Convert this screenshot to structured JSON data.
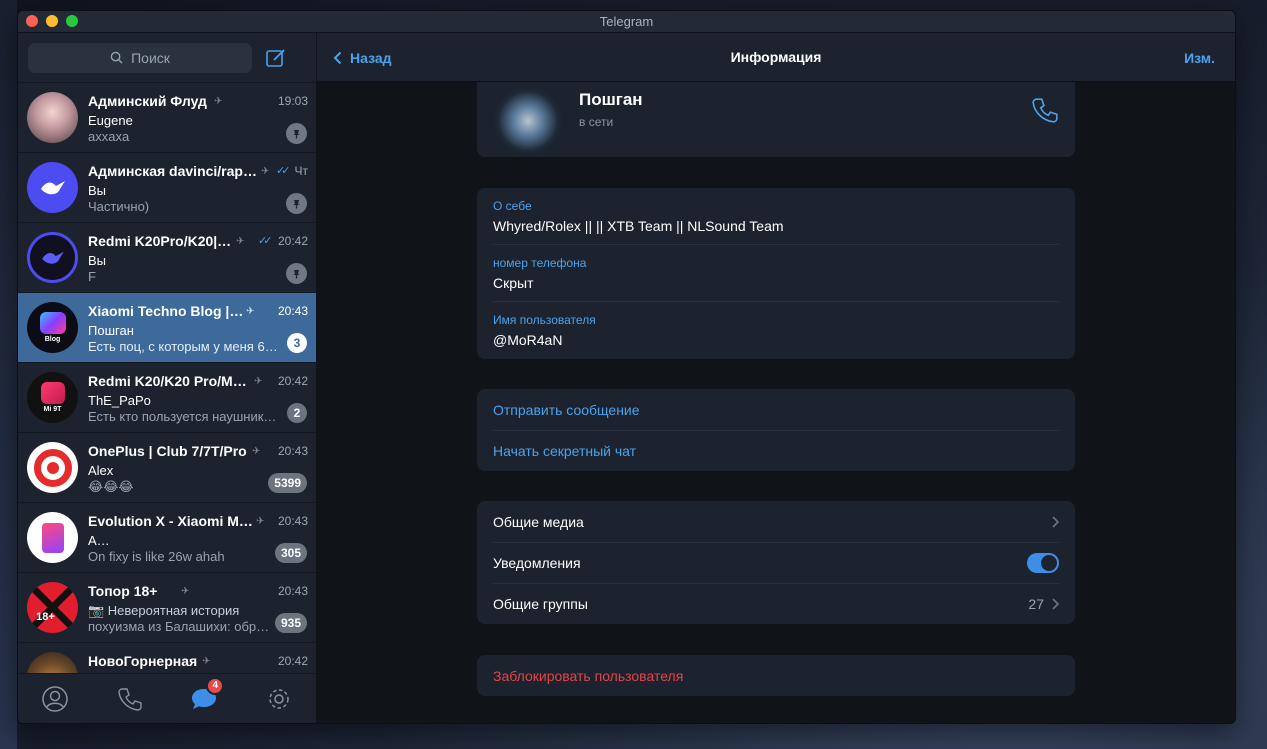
{
  "window": {
    "title": "Telegram"
  },
  "sidebar": {
    "search_placeholder": "Поиск",
    "chats": [
      {
        "name": "Админский Флуд",
        "time": "19:03",
        "sender": "Eugene",
        "preview": "axxaxa",
        "pinned": true,
        "muted": true
      },
      {
        "name": "Админская davinci/rap…",
        "time": "Чт",
        "sender": "Вы",
        "preview": "Частично)",
        "pinned": true,
        "muted": true,
        "read": true
      },
      {
        "name": "Redmi K20Pro/K20|…",
        "time": "20:42",
        "sender": "Вы",
        "preview": "F",
        "pinned": true,
        "muted": true,
        "read": true
      },
      {
        "name": "Xiaomi Techno Blog |…",
        "time": "20:43",
        "sender": "Пошган",
        "preview": "Есть поц, с которым у меня 6…",
        "unread": "3",
        "active": true,
        "muted": true,
        "avatar_text": "Blog"
      },
      {
        "name": "Redmi K20/K20 Pro/M…",
        "time": "20:42",
        "sender": "ThE_PaPo",
        "preview": "Есть кто пользуется наушник…",
        "unread": "2",
        "muted": true,
        "avatar_text": "Mi 9T"
      },
      {
        "name": "OnePlus | Club 7/7T/Pro",
        "time": "20:43",
        "sender": "Alex",
        "preview": "😂😂😂",
        "unread": "5399",
        "muted": true
      },
      {
        "name": "Evolution X - Xiaomi M…",
        "time": "20:43",
        "sender": "A…",
        "preview": "On fixy is like 26w ahah",
        "unread": "305",
        "muted": true
      },
      {
        "name": "Топор 18+",
        "time": "20:43",
        "sender": "📷 Невероятная история",
        "preview": "похуизма из Балашихи: обр…",
        "unread": "935",
        "muted": true,
        "avatar_text": "18+"
      },
      {
        "name": "НовоГорнерная",
        "time": "20:42",
        "sender": "",
        "preview": "",
        "muted": true
      }
    ],
    "tabs": {
      "chats_badge": "4"
    }
  },
  "nav": {
    "back": "Назад",
    "title": "Информация",
    "edit": "Изм."
  },
  "profile": {
    "name": "Пошган",
    "status": "в сети"
  },
  "info": {
    "bio_label": "О себе",
    "bio": "Whyred/Rolex || || XTB Team || NLSound Team",
    "phone_label": "номер телефона",
    "phone": "Скрыт",
    "username_label": "Имя пользователя",
    "username": "@MoR4aN"
  },
  "actions": {
    "send_message": "Отправить сообщение",
    "secret_chat": "Начать секретный чат"
  },
  "settings": {
    "media": "Общие медиа",
    "notifications": "Уведомления",
    "notifications_on": true,
    "groups": "Общие группы",
    "groups_count": "27"
  },
  "block": "Заблокировать пользователя",
  "colors": {
    "accent": "#4aa3ed",
    "active_chat": "#3d6a9b",
    "danger": "#e0454a",
    "toggle": "#3d8ee6"
  }
}
